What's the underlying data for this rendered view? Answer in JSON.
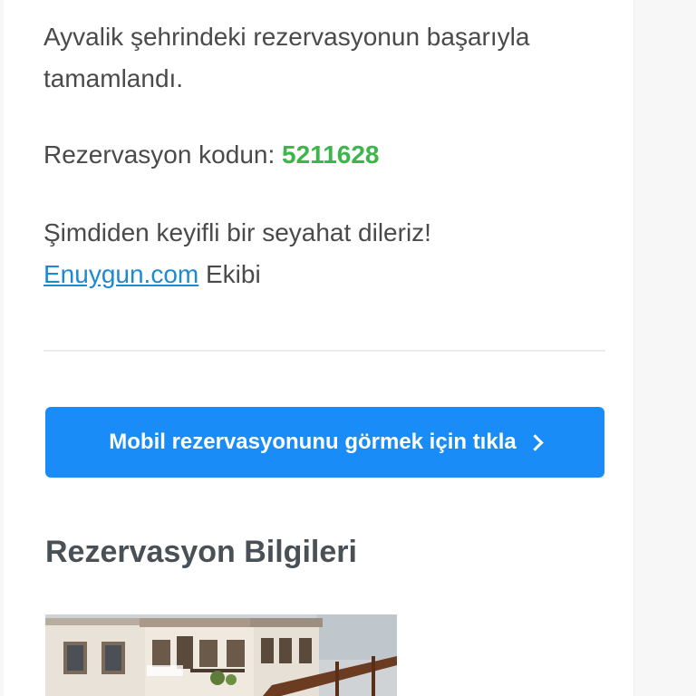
{
  "message": {
    "line1": "Ayvalik şehrindeki rezervasyonun başarıyla tamamlandı.",
    "code_label": "Rezervasyon kodun: ",
    "code_value": "5211628",
    "wish": "Şimdiden keyifli bir seyahat dileriz!",
    "site_link": "Enuygun.com",
    "team": " Ekibi"
  },
  "cta": {
    "label": "Mobil rezervasyonunu görmek için tıkla"
  },
  "section": {
    "title": "Rezervasyon Bilgileri"
  },
  "colors": {
    "accent_blue": "#1a8cf7",
    "code_green": "#3cb54a",
    "link_blue": "#1b8ad1"
  }
}
